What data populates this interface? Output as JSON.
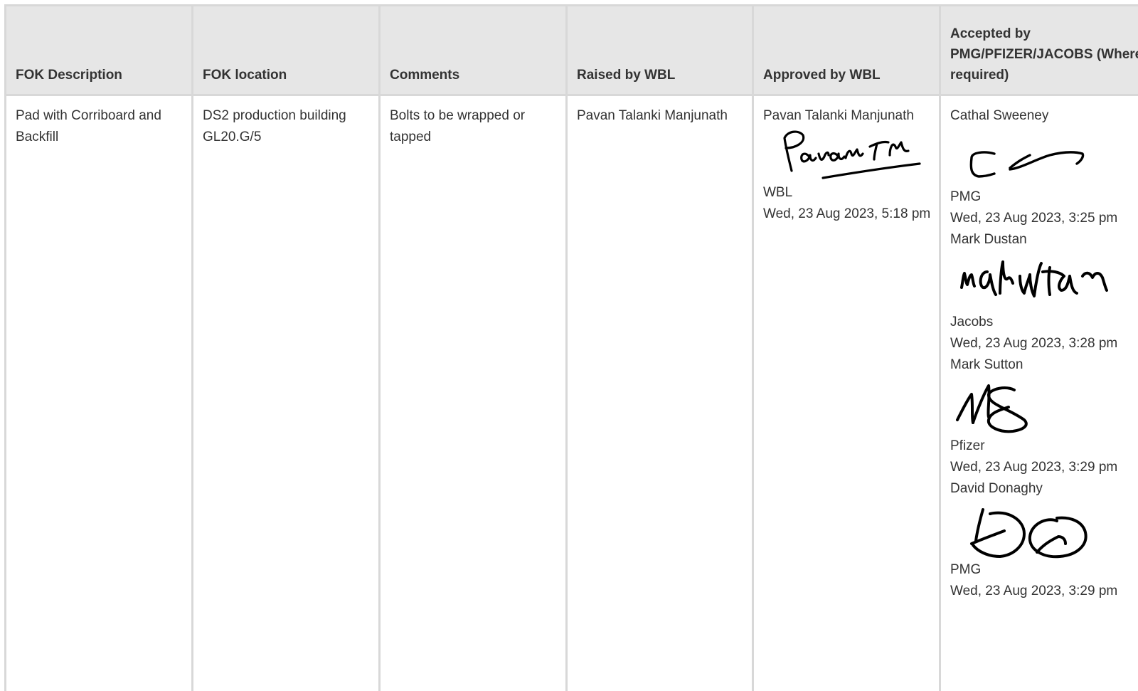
{
  "headers": {
    "fok_description": "FOK Description",
    "fok_location": "FOK location",
    "comments": "Comments",
    "raised_by": "Raised by WBL",
    "approved_by": "Approved by WBL",
    "accepted_by": "Accepted by PMG/PFIZER/JACOBS (Where required)"
  },
  "row": {
    "fok_description": "Pad with Corriboard and Backfill",
    "fok_location": "DS2 production building GL20.G/5",
    "comments": "Bolts to be wrapped or tapped",
    "raised_by": "Pavan Talanki Manjunath",
    "approved": {
      "name": "Pavan Talanki Manjunath",
      "signature_text": "PavanTm",
      "company": "WBL",
      "timestamp": "Wed, 23 Aug 2023, 5:18 pm"
    },
    "accepted": [
      {
        "name": "Cathal Sweeney",
        "signature_text": "C",
        "company": "PMG",
        "timestamp": "Wed, 23 Aug 2023, 3:25 pm"
      },
      {
        "name": "Mark Dustan",
        "signature_text": "markdustan",
        "company": "Jacobs",
        "timestamp": "Wed, 23 Aug 2023, 3:28 pm"
      },
      {
        "name": "Mark Sutton",
        "signature_text": "MS",
        "company": "Pfizer",
        "timestamp": "Wed, 23 Aug 2023, 3:29 pm"
      },
      {
        "name": "David Donaghy",
        "signature_text": "DD",
        "company": "PMG",
        "timestamp": "Wed, 23 Aug 2023, 3:29 pm"
      }
    ]
  }
}
